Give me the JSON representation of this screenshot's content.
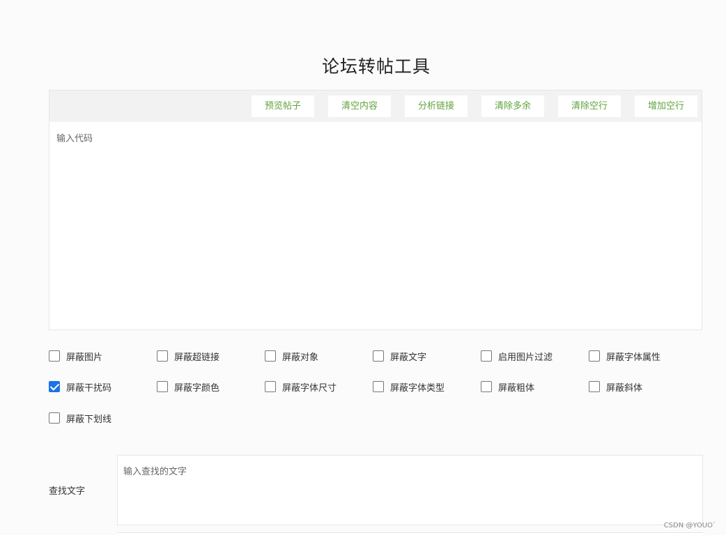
{
  "title": "论坛转帖工具",
  "toolbar": {
    "buttons": [
      "预览帖子",
      "清空内容",
      "分析链接",
      "清除多余",
      "清除空行",
      "增加空行"
    ]
  },
  "editor": {
    "placeholder": "输入代码",
    "value": ""
  },
  "options": [
    {
      "label": "屏蔽图片",
      "checked": false
    },
    {
      "label": "屏蔽超链接",
      "checked": false
    },
    {
      "label": "屏蔽对象",
      "checked": false
    },
    {
      "label": "屏蔽文字",
      "checked": false
    },
    {
      "label": "启用图片过滤",
      "checked": false
    },
    {
      "label": "屏蔽字体属性",
      "checked": false
    },
    {
      "label": "屏蔽干扰码",
      "checked": true
    },
    {
      "label": "屏蔽字颜色",
      "checked": false
    },
    {
      "label": "屏蔽字体尺寸",
      "checked": false
    },
    {
      "label": "屏蔽字体类型",
      "checked": false
    },
    {
      "label": "屏蔽粗体",
      "checked": false
    },
    {
      "label": "屏蔽斜体",
      "checked": false
    },
    {
      "label": "屏蔽下划线",
      "checked": false
    }
  ],
  "find": {
    "label": "查找文字",
    "placeholder": "输入查找的文字",
    "value": ""
  },
  "watermark": "CSDN @YOUO`",
  "colors": {
    "button_text": "#5fa33b",
    "checkbox_checked": "#1a73e8",
    "toolbar_bg": "#f2f2f2"
  }
}
